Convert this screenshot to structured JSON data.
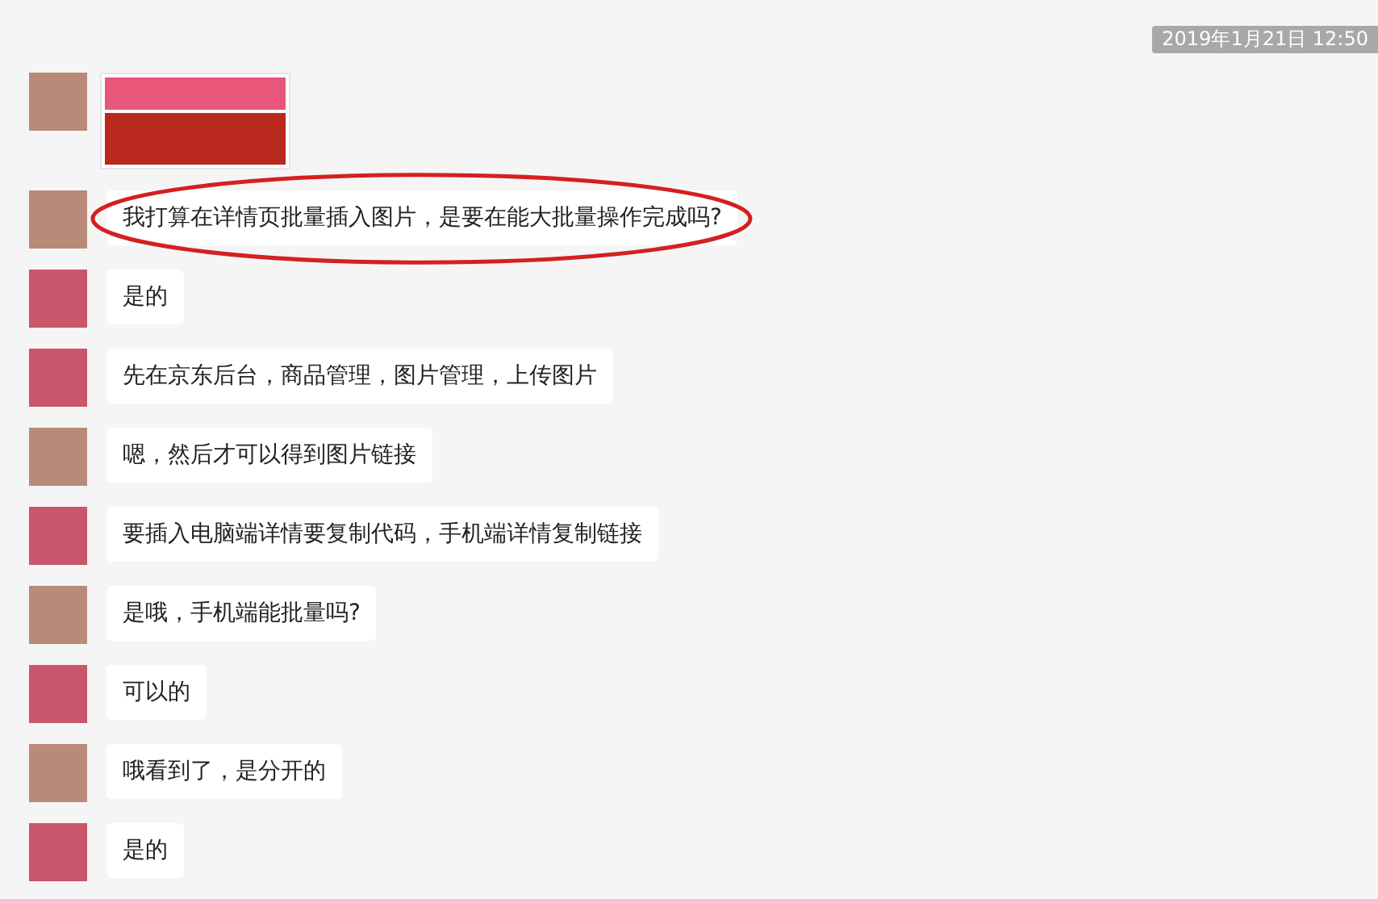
{
  "timestamp": "2019年1月21日 12:50",
  "messages": [
    {
      "kind": "image",
      "pixelated_avatar": true,
      "highlighted": false
    },
    {
      "kind": "text",
      "pixelated_avatar": true,
      "text": "我打算在详情页批量插入图片，是要在能大批量操作完成吗?",
      "highlighted": true
    },
    {
      "kind": "text",
      "pixelated_avatar": false,
      "text": "是的",
      "highlighted": false
    },
    {
      "kind": "text",
      "pixelated_avatar": false,
      "text": "先在京东后台，商品管理，图片管理，上传图片",
      "highlighted": false
    },
    {
      "kind": "text",
      "pixelated_avatar": true,
      "text": "嗯，然后才可以得到图片链接",
      "highlighted": false
    },
    {
      "kind": "text",
      "pixelated_avatar": false,
      "text": "要插入电脑端详情要复制代码，手机端详情复制链接",
      "highlighted": false
    },
    {
      "kind": "text",
      "pixelated_avatar": true,
      "text": "是哦，手机端能批量吗?",
      "highlighted": false
    },
    {
      "kind": "text",
      "pixelated_avatar": false,
      "text": "可以的",
      "highlighted": false
    },
    {
      "kind": "text",
      "pixelated_avatar": true,
      "text": "哦看到了，是分开的",
      "highlighted": false
    },
    {
      "kind": "text",
      "pixelated_avatar": false,
      "text": "是的",
      "highlighted": false
    }
  ]
}
